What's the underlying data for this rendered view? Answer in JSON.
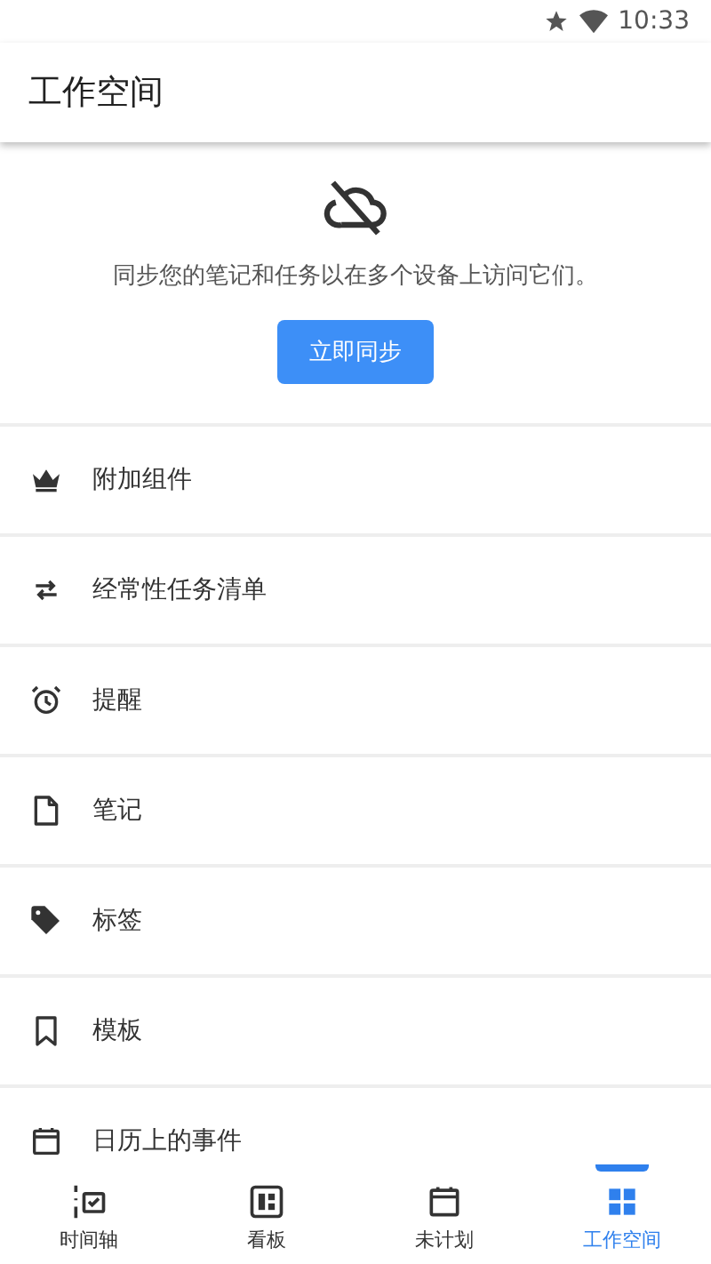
{
  "status_bar": {
    "time": "10:33"
  },
  "app_bar": {
    "title": "工作空间"
  },
  "sync": {
    "message": "同步您的笔记和任务以在多个设备上访问它们。",
    "button": "立即同步"
  },
  "items": [
    {
      "label": "附加组件"
    },
    {
      "label": "经常性任务清单"
    },
    {
      "label": "提醒"
    },
    {
      "label": "笔记"
    },
    {
      "label": "标签"
    },
    {
      "label": "模板"
    },
    {
      "label": "日历上的事件"
    }
  ],
  "bottom_nav": [
    {
      "label": "时间轴",
      "selected": false
    },
    {
      "label": "看板",
      "selected": false
    },
    {
      "label": "未计划",
      "selected": false
    },
    {
      "label": "工作空间",
      "selected": true
    }
  ]
}
